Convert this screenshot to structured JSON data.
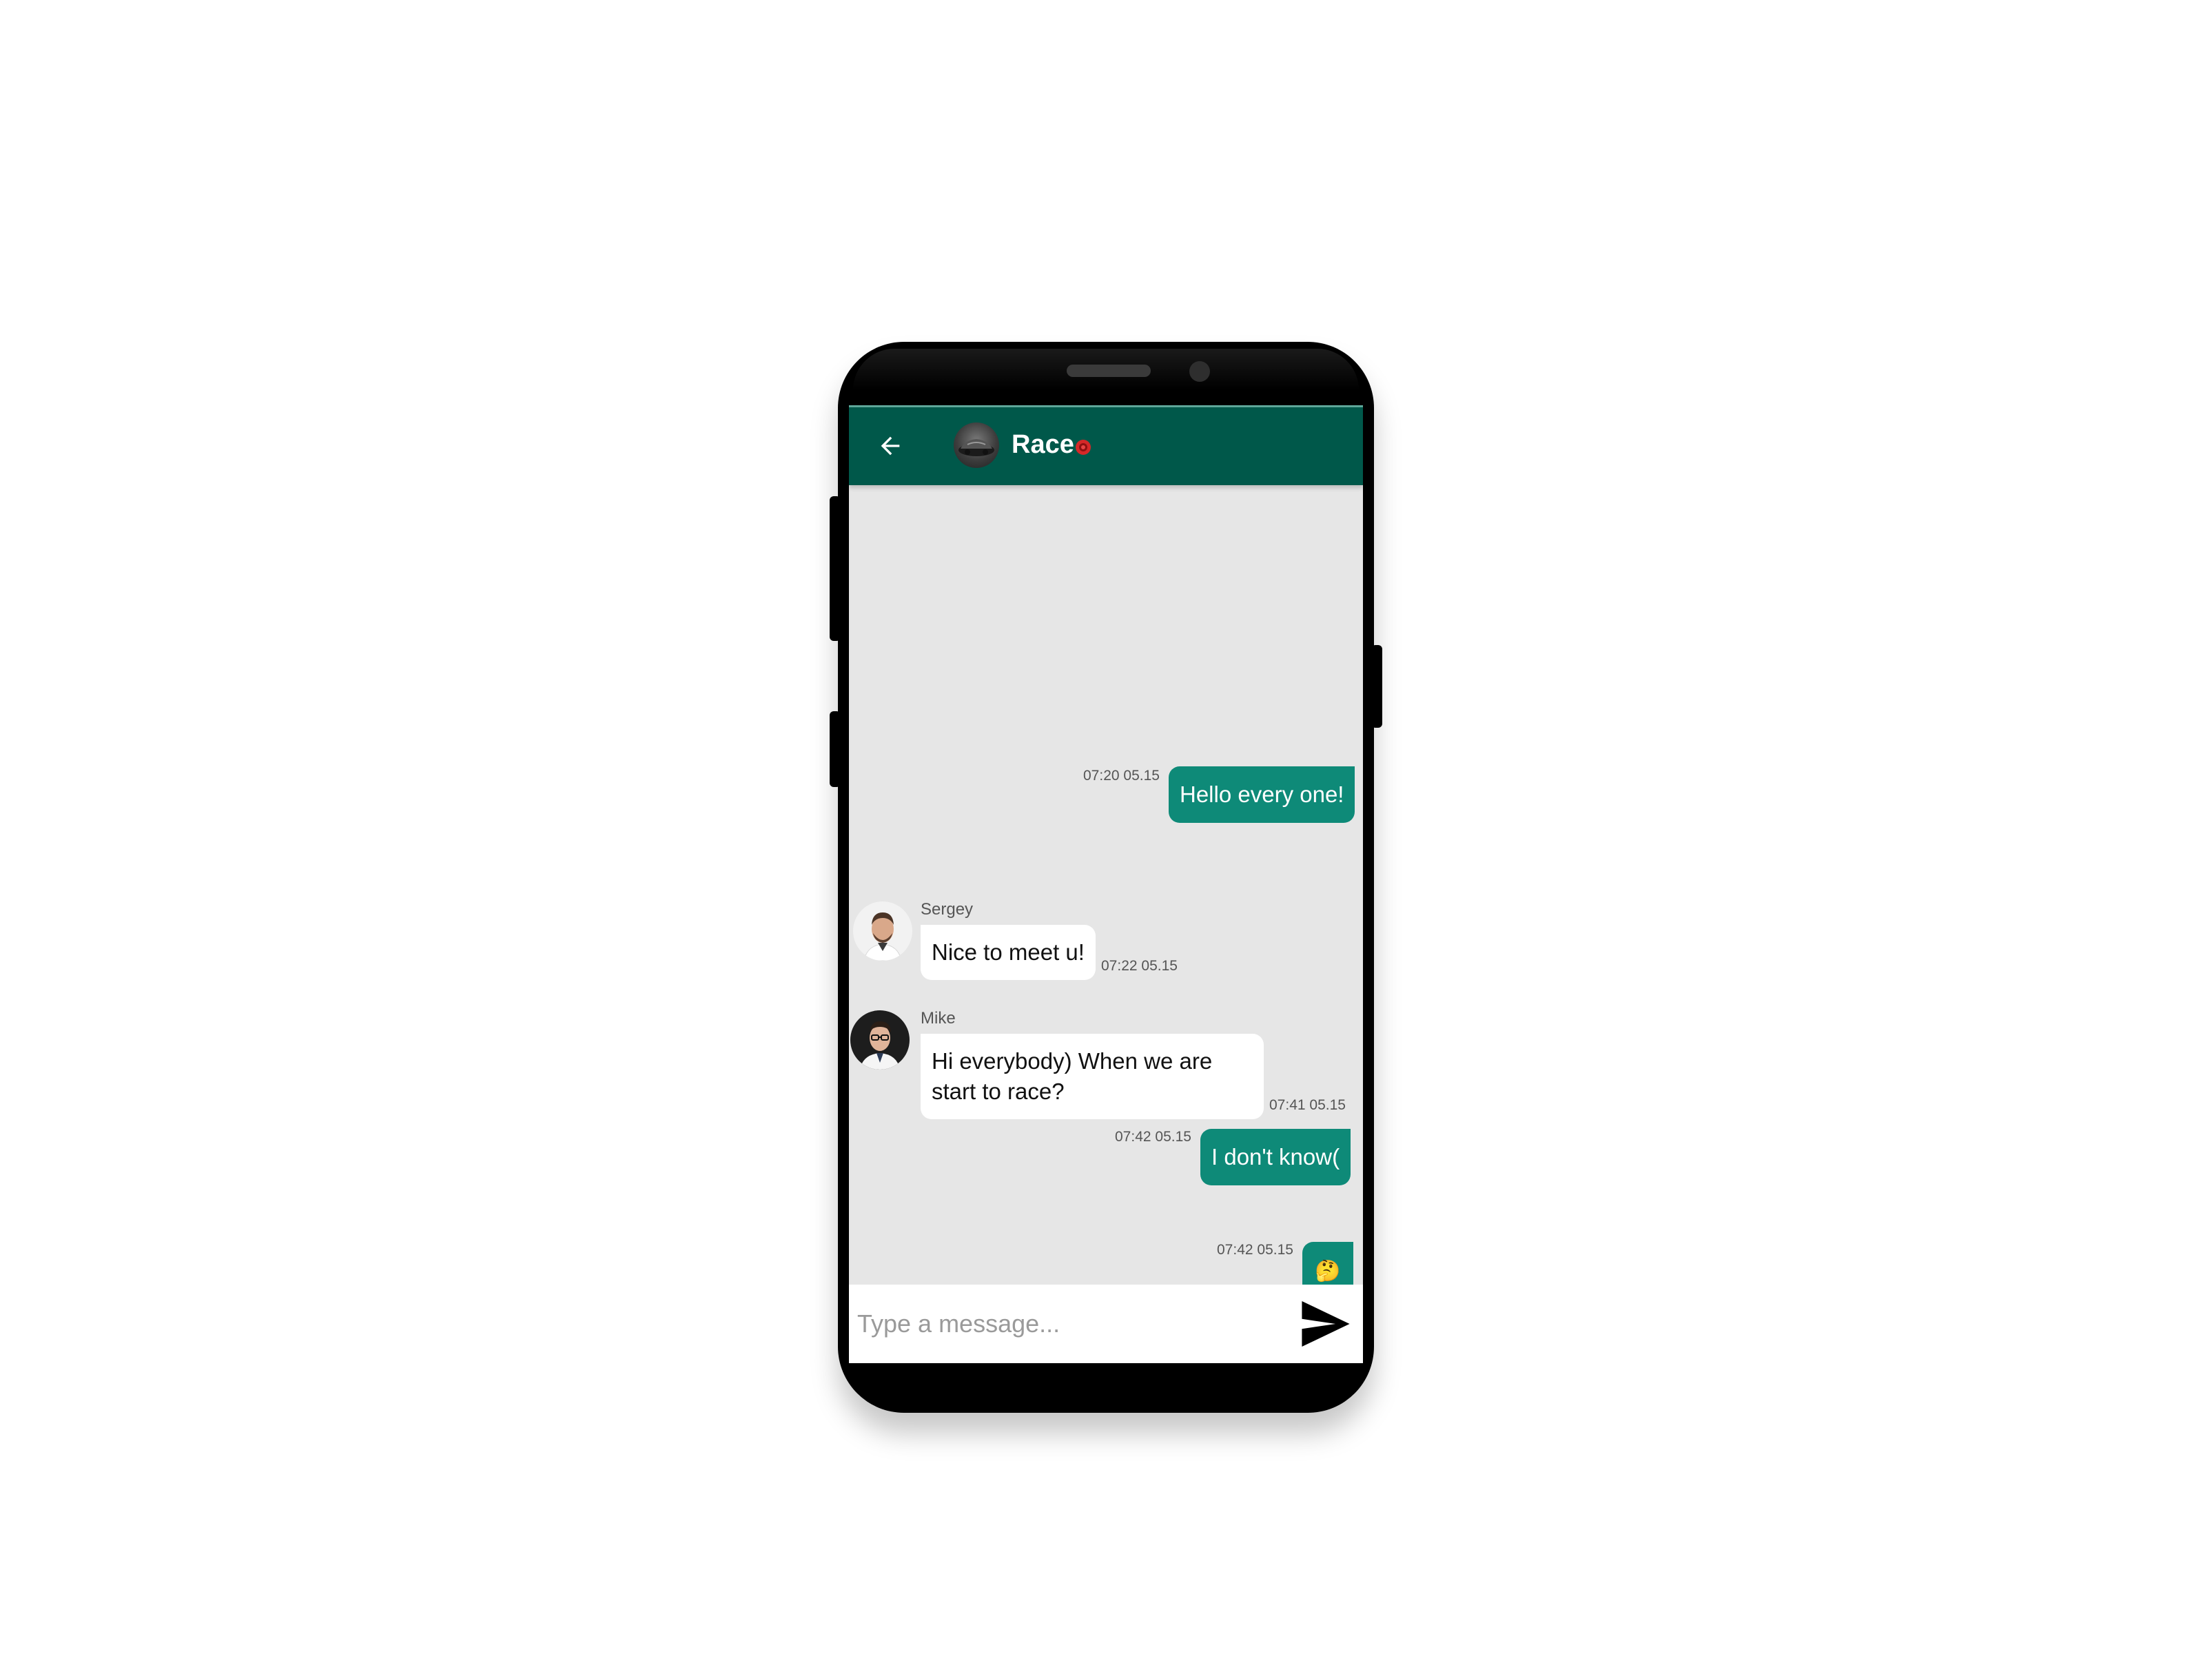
{
  "header": {
    "title": "Race",
    "back_icon": "arrow-left-icon",
    "avatar_icon": "car-avatar-icon",
    "badge_icon": "red-dot-icon",
    "bar_color": "#00584a"
  },
  "messages": [
    {
      "direction": "outgoing",
      "text": "Hello every one!",
      "time": "07:20 05.15"
    },
    {
      "direction": "incoming",
      "sender": "Sergey",
      "text": "Nice to meet u!",
      "time": "07:22 05.15"
    },
    {
      "direction": "incoming",
      "sender": "Mike",
      "text": "Hi everybody) When we are start to race?",
      "time": "07:41 05.15"
    },
    {
      "direction": "outgoing",
      "text": "I don't know(",
      "time": "07:42 05.15"
    },
    {
      "direction": "outgoing",
      "text": "🤔",
      "time": "07:42 05.15"
    }
  ],
  "input": {
    "placeholder": "Type a message...",
    "value": ""
  },
  "send_icon": "send-arrow-icon",
  "colors": {
    "outgoing_bubble": "#0e8a78",
    "incoming_bubble": "#ffffff",
    "chat_background": "#e6e6e6"
  }
}
